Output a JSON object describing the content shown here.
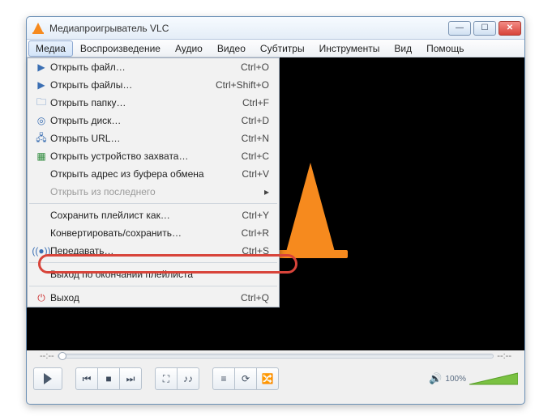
{
  "window": {
    "title": "Медиапроигрыватель VLC"
  },
  "menubar": {
    "media": "Медиа",
    "playback": "Воспроизведение",
    "audio": "Аудио",
    "video": "Видео",
    "subtitles": "Субтитры",
    "tools": "Инструменты",
    "view": "Вид",
    "help": "Помощь"
  },
  "menu": {
    "open_file": "Открыть файл…",
    "open_file_sc": "Ctrl+O",
    "open_files": "Открыть файлы…",
    "open_files_sc": "Ctrl+Shift+O",
    "open_folder": "Открыть папку…",
    "open_folder_sc": "Ctrl+F",
    "open_disc": "Открыть диск…",
    "open_disc_sc": "Ctrl+D",
    "open_url": "Открыть URL…",
    "open_url_sc": "Ctrl+N",
    "open_capture": "Открыть устройство захвата…",
    "open_capture_sc": "Ctrl+C",
    "open_clipboard": "Открыть адрес из буфера обмена",
    "open_clipboard_sc": "Ctrl+V",
    "open_recent": "Открыть из последнего",
    "save_playlist": "Сохранить плейлист как…",
    "save_playlist_sc": "Ctrl+Y",
    "convert": "Конвертировать/сохранить…",
    "convert_sc": "Ctrl+R",
    "stream": "Передавать…",
    "stream_sc": "Ctrl+S",
    "quit_after": "Выход по окончании плейлиста",
    "quit": "Выход",
    "quit_sc": "Ctrl+Q"
  },
  "seek": {
    "left": "--:--",
    "right": "--:--"
  },
  "volume": {
    "percent": "100%"
  }
}
